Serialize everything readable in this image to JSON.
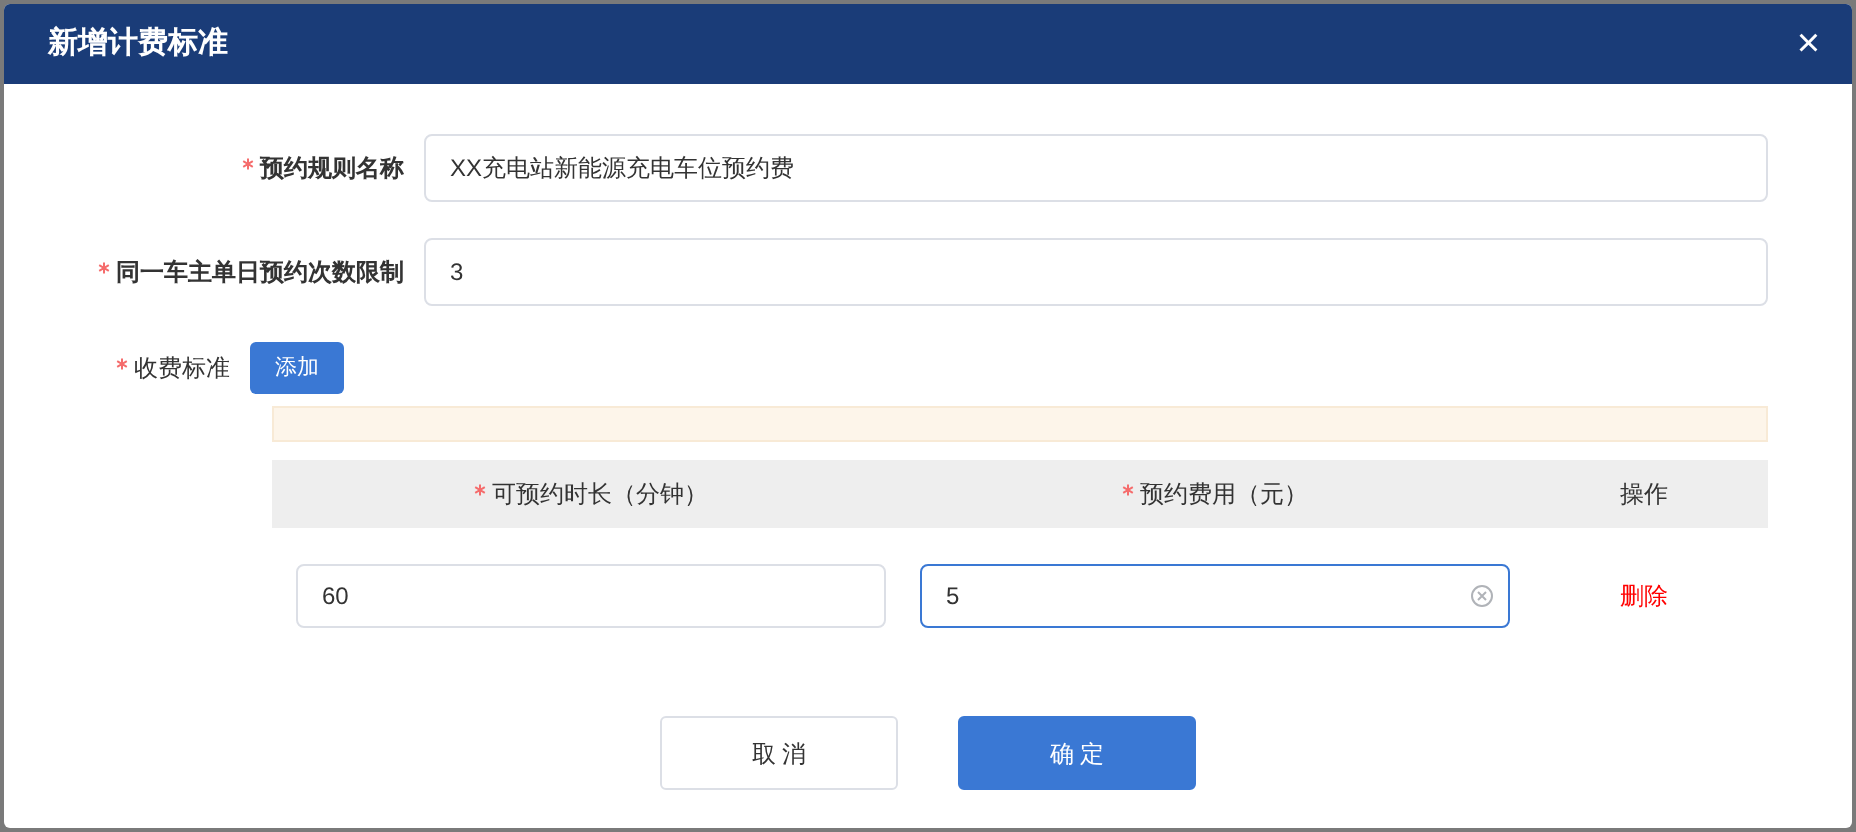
{
  "dialog": {
    "title": "新增计费标准",
    "close": "×"
  },
  "fields": [
    {
      "kind": "input",
      "label": "预约规则名称",
      "required": true,
      "value": "XX充电站新能源充电车位预约费"
    },
    {
      "kind": "input",
      "label": "同一车主单日预约次数限制",
      "required": true,
      "value": "3"
    },
    {
      "kind": "add",
      "label": "收费标准",
      "required": true,
      "button": "添加"
    }
  ],
  "table": {
    "columns": [
      {
        "label": "可预约时长（分钟）",
        "required": true
      },
      {
        "label": "预约费用（元）",
        "required": true
      },
      {
        "label": "操作",
        "required": false
      }
    ],
    "rows": [
      {
        "cells": [
          {
            "value": "60",
            "focused": false
          },
          {
            "value": "5",
            "focused": true
          }
        ],
        "action": "删除"
      }
    ]
  },
  "buttons": [
    {
      "label": "取 消",
      "kind": "secondary"
    },
    {
      "label": "确 定",
      "kind": "primary"
    }
  ]
}
